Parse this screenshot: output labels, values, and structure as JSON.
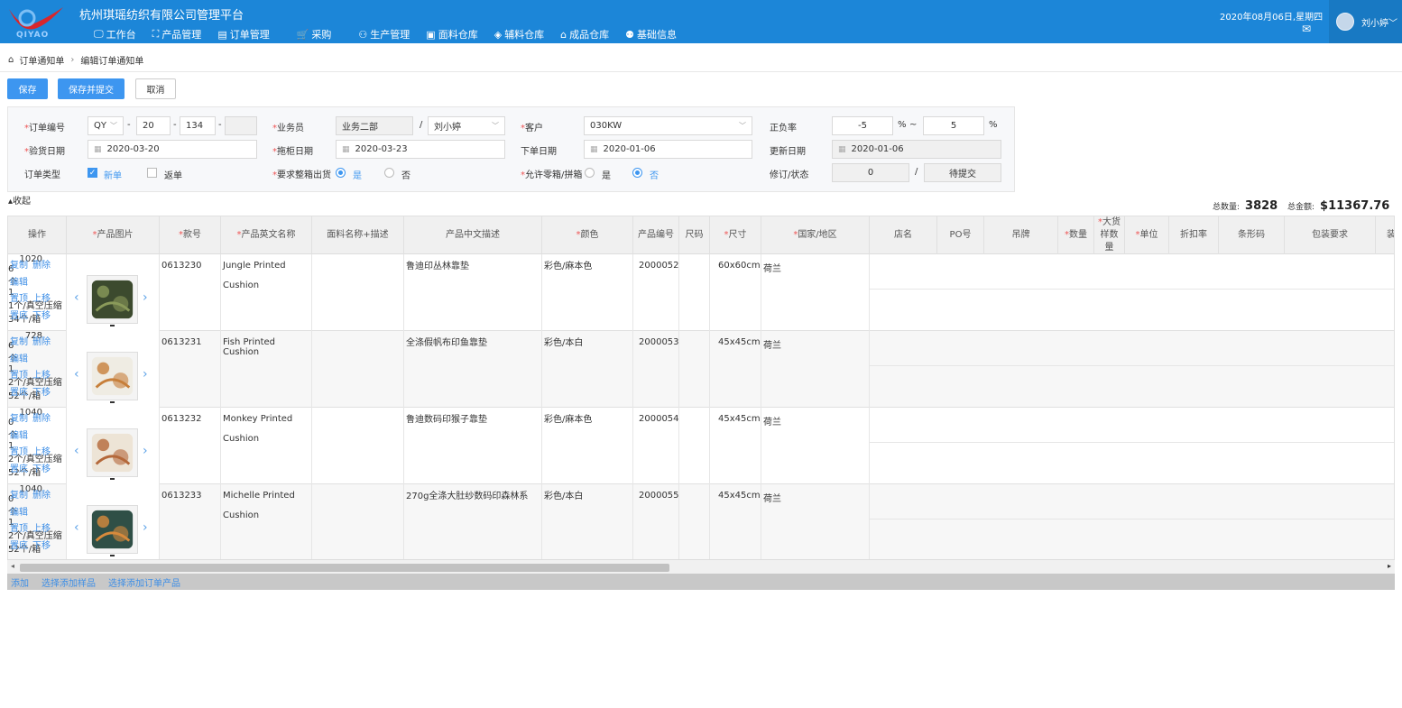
{
  "header": {
    "logo_text": "QIYAO",
    "app_title": "杭州琪瑶纺织有限公司管理平台",
    "date": "2020年08月06日,星期四",
    "user": "刘小婷",
    "nav": [
      {
        "label": "工作台",
        "icon": "monitor-icon",
        "glyph": "🖵"
      },
      {
        "label": "产品管理",
        "icon": "bag-icon",
        "glyph": "⛶"
      },
      {
        "label": "订单管理",
        "icon": "document-icon",
        "glyph": "▤"
      },
      {
        "label": "采购",
        "icon": "cart-icon",
        "glyph": "🛒"
      },
      {
        "label": "生产管理",
        "icon": "grid-icon",
        "glyph": "⚇"
      },
      {
        "label": "面料仓库",
        "icon": "box-icon",
        "glyph": "▣"
      },
      {
        "label": "辅料仓库",
        "icon": "layers-icon",
        "glyph": "◈"
      },
      {
        "label": "成品仓库",
        "icon": "home-icon",
        "glyph": "⌂"
      },
      {
        "label": "基础信息",
        "icon": "users-icon",
        "glyph": "⚉"
      }
    ]
  },
  "breadcrumb": {
    "root": "订单通知单",
    "current": "编辑订单通知单"
  },
  "toolbar": {
    "save": "保存",
    "save_submit": "保存并提交",
    "cancel": "取消"
  },
  "form": {
    "order_no": {
      "label": "订单编号",
      "prefix": "QY",
      "part1": "20",
      "part2": "134",
      "part3": ""
    },
    "salesman": {
      "label": "业务员",
      "dept": "业务二部",
      "name": "刘小婷"
    },
    "customer": {
      "label": "客户",
      "value": "030KW"
    },
    "tolerance": {
      "label": "正负率",
      "min": "-5",
      "max": "5",
      "unit": "%",
      "tilde": "~"
    },
    "inspect_date": {
      "label": "验货日期",
      "value": "2020-03-20"
    },
    "container_date": {
      "label": "拖柜日期",
      "value": "2020-03-23"
    },
    "order_date": {
      "label": "下单日期",
      "value": "2020-01-06"
    },
    "update_date": {
      "label": "更新日期",
      "value": "2020-01-06"
    },
    "order_type": {
      "label": "订单类型",
      "opt1": "新单",
      "opt2": "返单"
    },
    "whole_box": {
      "label": "要求整箱出货",
      "yes": "是",
      "no": "否"
    },
    "mixed_box": {
      "label": "允许零箱/拼箱",
      "yes": "是",
      "no": "否"
    },
    "revision": {
      "label": "修订/状态",
      "value": "0",
      "slash": "/",
      "status": "待提交"
    }
  },
  "collapse_label": "收起",
  "totals": {
    "qty_label": "总数量:",
    "qty": "3828",
    "amount_label": "总金额:",
    "amount": "$11367.76"
  },
  "table": {
    "headers": [
      "操作",
      "产品图片",
      "款号",
      "产品英文名称",
      "面料名称+描述",
      "产品中文描述",
      "颜色",
      "产品编号",
      "尺码",
      "尺寸",
      "国家/地区",
      "店名",
      "PO号",
      "吊牌",
      "数量",
      "大货样数量",
      "单位",
      "折扣率",
      "条形码",
      "包装要求",
      "装"
    ],
    "ops": {
      "copy": "复制",
      "delete": "删除",
      "edit": "编辑",
      "top": "置顶",
      "up": "上移",
      "bottom": "置底",
      "down": "下移"
    },
    "rows": [
      {
        "style": "0613230",
        "en1": "Jungle Printed",
        "en2": "Cushion",
        "cn": "鲁迪印丛林靠垫",
        "color": "彩色/麻本色",
        "code": "2000052",
        "size": "60x60cm",
        "country": "荷兰",
        "qty": "1020",
        "sample": "6",
        "unit": "个",
        "discount": "1",
        "pack1": "1个/真空压缩",
        "pack2": "34个/箱"
      },
      {
        "style": "0613231",
        "en1": "Fish Printed Cushion",
        "en2": "",
        "cn": "全涤假帆布印鱼靠垫",
        "color": "彩色/本白",
        "code": "2000053",
        "size": "45x45cm",
        "country": "荷兰",
        "qty": "728",
        "sample": "6",
        "unit": "个",
        "discount": "1",
        "pack1": "2个/真空压缩",
        "pack2": "52个/箱"
      },
      {
        "style": "0613232",
        "en1": "Monkey Printed",
        "en2": "Cushion",
        "cn": "鲁迪数码印猴子靠垫",
        "color": "彩色/麻本色",
        "code": "2000054",
        "size": "45x45cm",
        "country": "荷兰",
        "qty": "1040",
        "sample": "0",
        "unit": "个",
        "discount": "1",
        "pack1": "2个/真空压缩",
        "pack2": "52个/箱"
      },
      {
        "style": "0613233",
        "en1": "Michelle Printed",
        "en2": "Cushion",
        "cn": "270g全涤大肚纱数码印森林系",
        "color": "彩色/本白",
        "code": "2000055",
        "size": "45x45cm",
        "country": "荷兰",
        "qty": "1040",
        "sample": "0",
        "unit": "个",
        "discount": "1",
        "pack1": "2个/真空压缩",
        "pack2": "52个/箱"
      }
    ]
  },
  "footer": {
    "add": "添加",
    "add_sample": "选择添加样品",
    "add_order_product": "选择添加订单产品"
  },
  "colors": {
    "header_bg": "#1c86d8",
    "primary": "#3d96f0",
    "link": "#3d8ee6",
    "required": "#e55555"
  }
}
